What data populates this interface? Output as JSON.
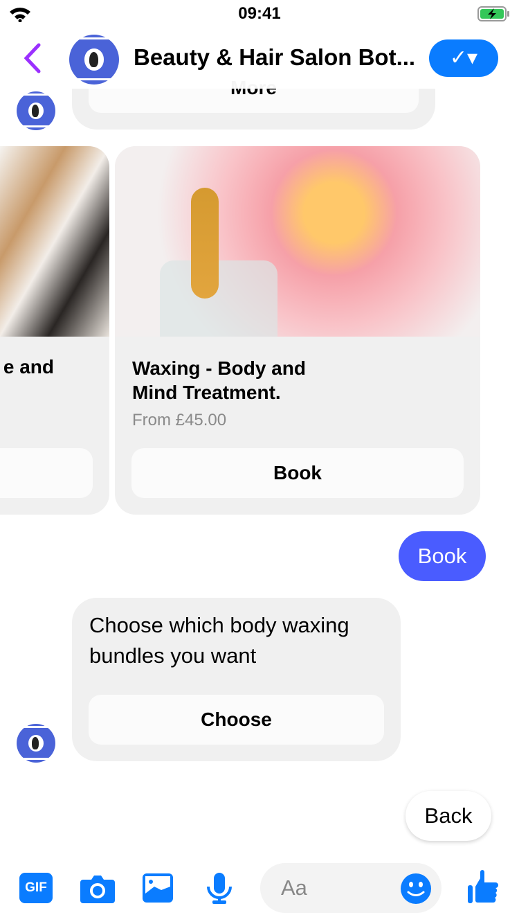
{
  "status": {
    "time": "09:41",
    "wifi_icon": "wifi-icon",
    "battery_icon": "battery-charging-icon"
  },
  "header": {
    "title": "Beauty & Hair Salon Bot...",
    "back_icon": "chevron-left-icon",
    "verify_label": "✓▾"
  },
  "messages": {
    "prev_button": "More",
    "cards": [
      {
        "title": "e and",
        "button": ""
      },
      {
        "title_line1": "Waxing - Body and",
        "title_line2": "Mind Treatment.",
        "subtitle": "From £45.00",
        "button": "Book"
      }
    ],
    "user_reply": "Book",
    "bot_text": "Choose which body waxing bundles you want",
    "bot_button": "Choose",
    "quick_reply": "Back"
  },
  "composer": {
    "placeholder": "Aa"
  },
  "colors": {
    "accent": "#0a7cff",
    "user_bubble": "#4a5cff",
    "back": "#9b30ff"
  }
}
